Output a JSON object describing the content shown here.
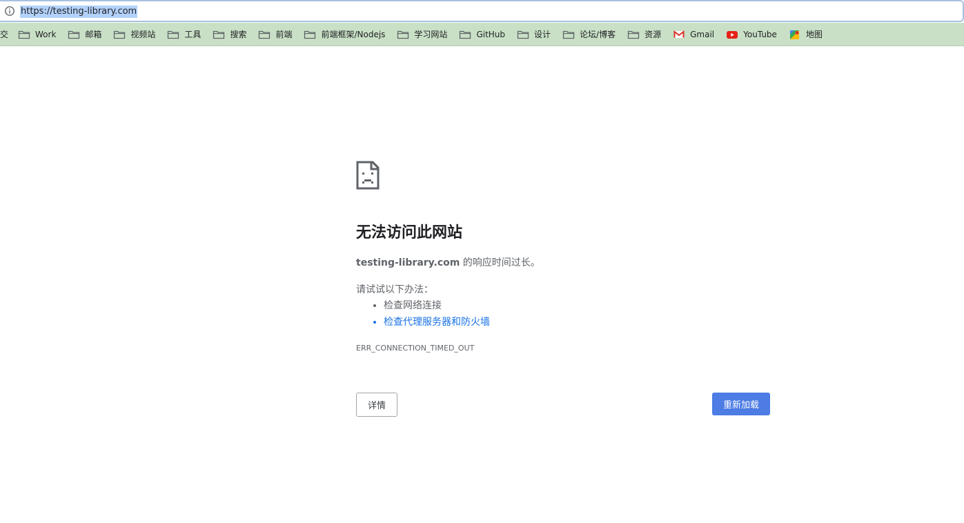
{
  "address_bar": {
    "url": "https://testing-library.com",
    "icon": "info-icon"
  },
  "bookmarks": {
    "cut_label": "交",
    "items": [
      {
        "label": "Work",
        "icon": "folder-icon"
      },
      {
        "label": "邮箱",
        "icon": "folder-icon"
      },
      {
        "label": "视频站",
        "icon": "folder-icon"
      },
      {
        "label": "工具",
        "icon": "folder-icon"
      },
      {
        "label": "搜索",
        "icon": "folder-icon"
      },
      {
        "label": "前端",
        "icon": "folder-icon"
      },
      {
        "label": "前端框架/Nodejs",
        "icon": "folder-icon"
      },
      {
        "label": "学习网站",
        "icon": "folder-icon"
      },
      {
        "label": "GitHub",
        "icon": "folder-icon"
      },
      {
        "label": "设计",
        "icon": "folder-icon"
      },
      {
        "label": "论坛/博客",
        "icon": "folder-icon"
      },
      {
        "label": "资源",
        "icon": "folder-icon"
      },
      {
        "label": "Gmail",
        "icon": "gmail-icon"
      },
      {
        "label": "YouTube",
        "icon": "youtube-icon"
      },
      {
        "label": "地图",
        "icon": "maps-icon"
      }
    ]
  },
  "error": {
    "icon": "sad-page-icon",
    "title": "无法访问此网站",
    "host": "testing-library.com",
    "desc_suffix": " 的响应时间过长。",
    "try_label": "请试试以下办法：",
    "suggestions": [
      {
        "text": "检查网络连接"
      },
      {
        "text": "检查代理服务器和防火墙"
      }
    ],
    "code": "ERR_CONNECTION_TIMED_OUT",
    "details_label": "详情",
    "reload_label": "重新加载"
  },
  "colors": {
    "bookmark_bar_bg": "#c9e0c6",
    "reload_button": "#4c7ce4",
    "link": "#1a73e8",
    "url_selection": "#b3d2fb"
  }
}
